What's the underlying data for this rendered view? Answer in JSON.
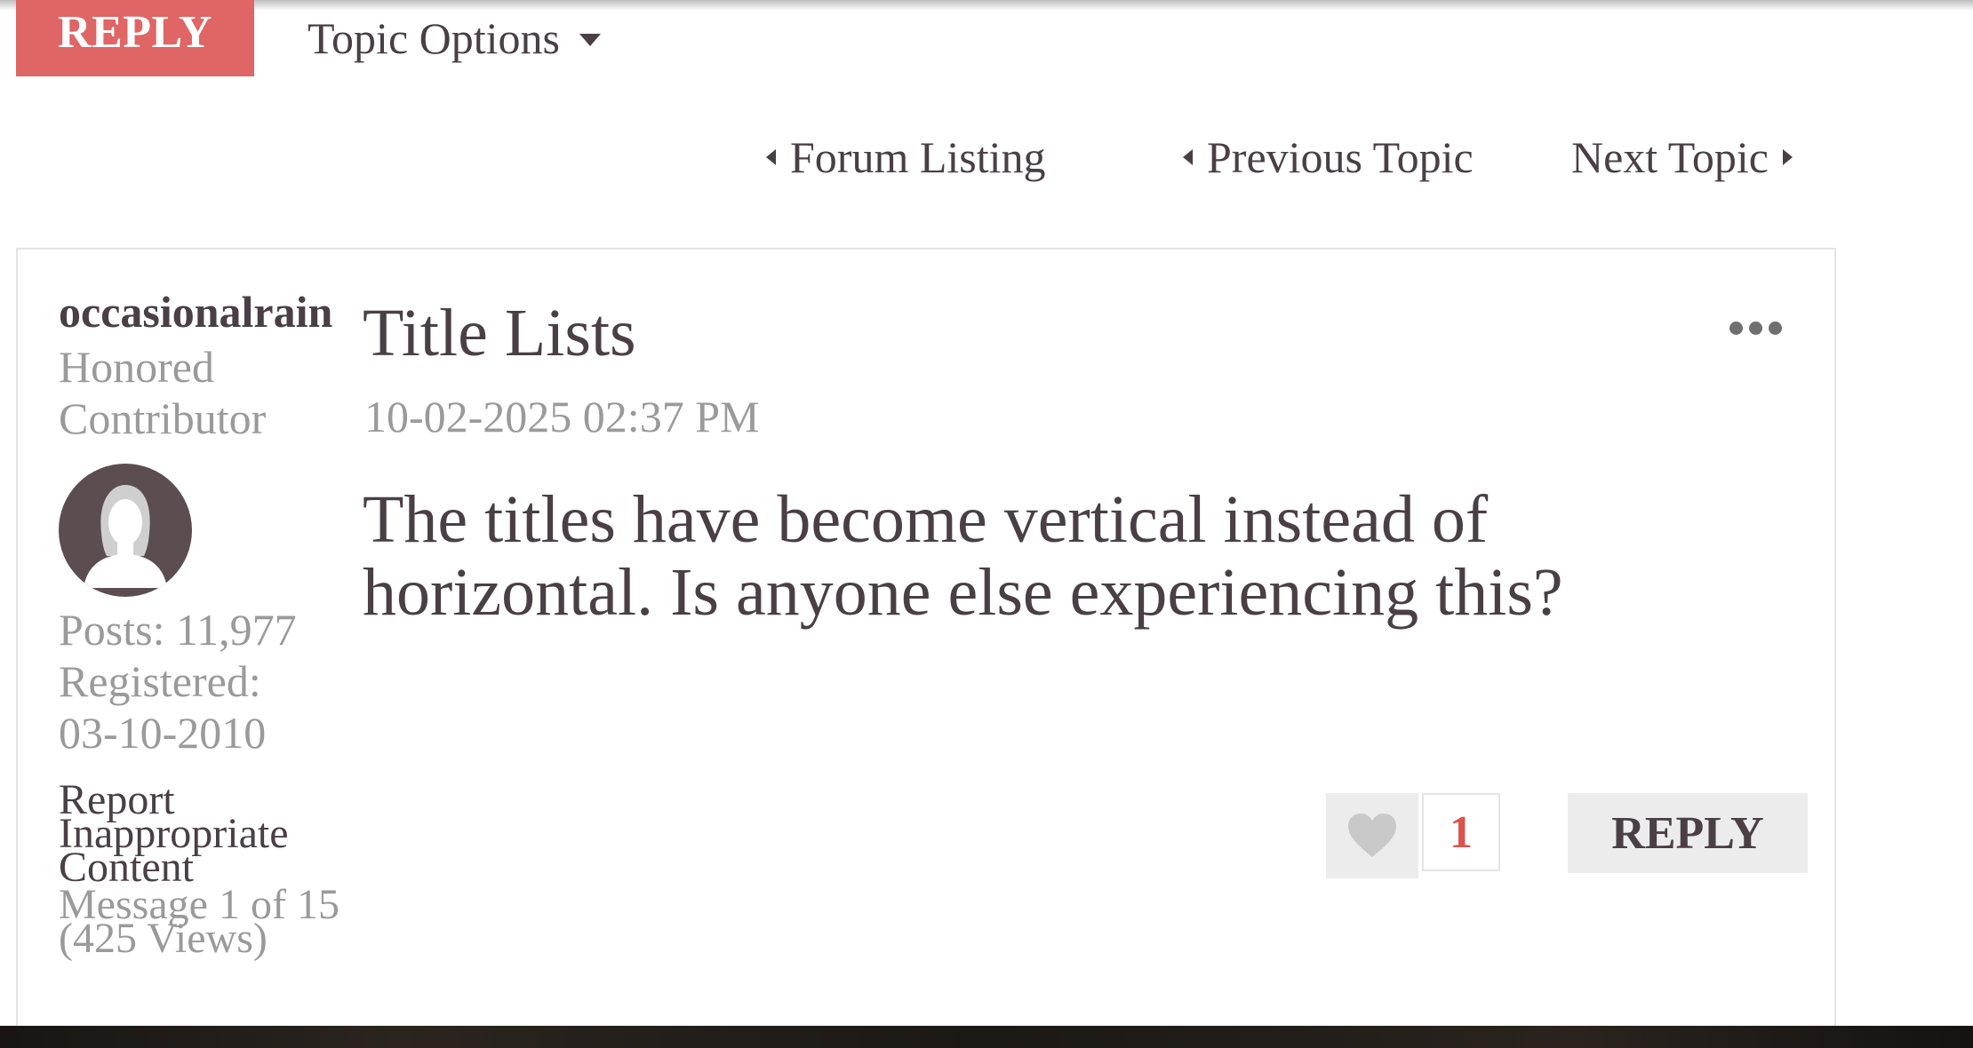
{
  "toolbar": {
    "reply_label": "REPLY",
    "topic_options_label": "Topic Options"
  },
  "nav": {
    "forum_listing": "Forum Listing",
    "previous_topic": "Previous Topic",
    "next_topic": "Next Topic"
  },
  "author": {
    "username": "occasionalrain",
    "rank": "Honored Contributor",
    "posts": "Posts: 11,977",
    "registered_label": "Registered:",
    "registered_date": "03-10-2010",
    "report_link": "Report Inappropriate Content",
    "message_count": "Message 1 of 15 (425 Views)"
  },
  "post": {
    "title": "Title Lists",
    "date": "10-02-2025 02:37 PM",
    "body": "The titles have become vertical instead of horizontal. Is anyone else experiencing this?",
    "kudos_count": "1",
    "reply_label": "REPLY"
  },
  "icons": {
    "topic_options_caret": "chevron-down-icon",
    "nav_left": "caret-left-icon",
    "nav_right": "caret-right-icon",
    "more": "more-options-icon",
    "kudo": "heart-icon",
    "avatar": "user-avatar-icon"
  },
  "colors": {
    "reply_accent": "#e06565",
    "kudos_count": "#d9534f",
    "text": "#4a3f45",
    "muted_text": "#9a9a9a"
  }
}
